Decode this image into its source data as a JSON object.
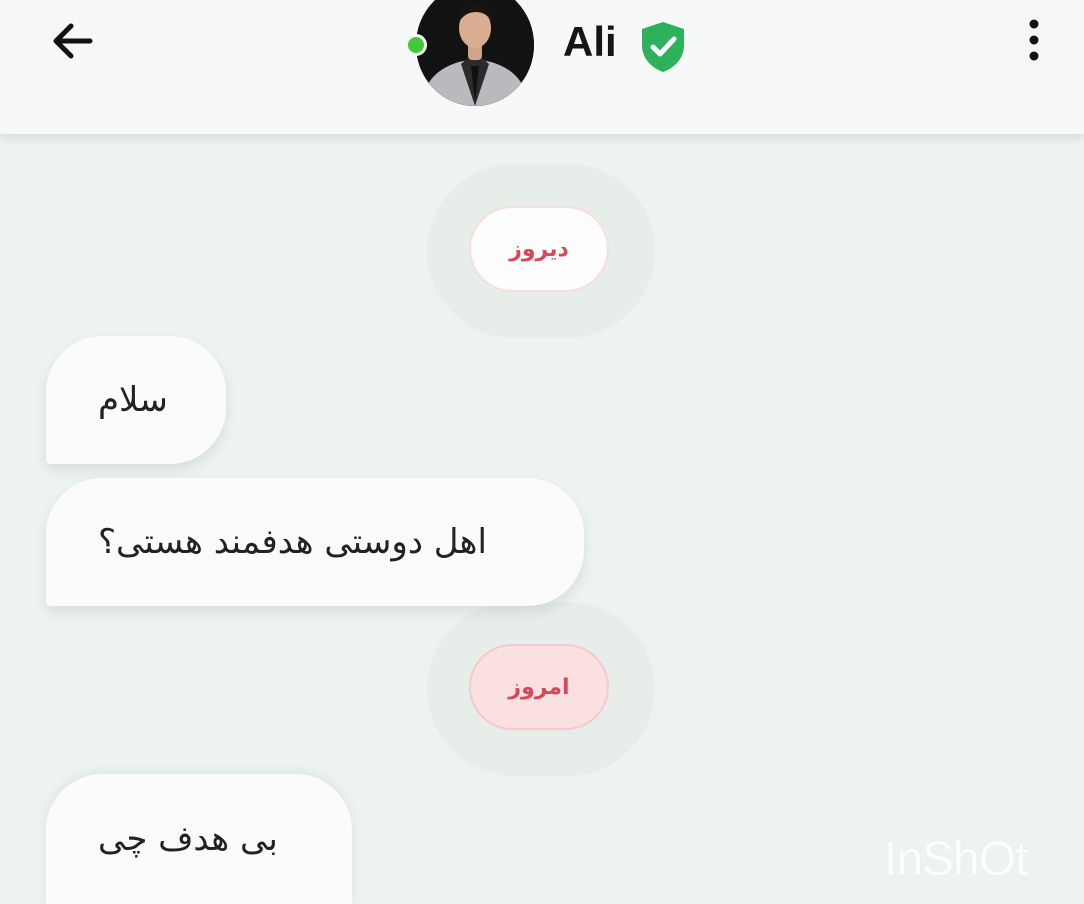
{
  "header": {
    "contact_name": "Ali",
    "online": true,
    "verified": true,
    "back_icon": "arrow-left-icon",
    "menu_icon": "more-vertical-icon",
    "verified_icon": "shield-check-icon"
  },
  "messages": [
    {
      "type": "date",
      "label": "دیروز"
    },
    {
      "type": "incoming",
      "text": "سلام"
    },
    {
      "type": "incoming",
      "text": "اهل دوستی هدفمند هستی؟"
    },
    {
      "type": "date",
      "label": "امروز"
    },
    {
      "type": "incoming",
      "text": "بی هدف چی"
    }
  ],
  "watermark": "InShOt",
  "colors": {
    "background": "#edf3ef",
    "header": "#f7f8f8",
    "online_dot": "#3fca3c",
    "verified_shield": "#2db15b",
    "date_text": "#d64857",
    "today_chip_bg": "#fbe0e1",
    "bubble": "#fbfbfb"
  }
}
